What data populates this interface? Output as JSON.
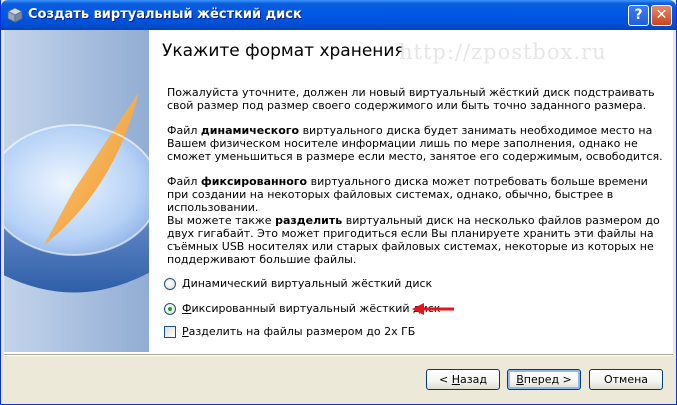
{
  "window": {
    "title": "Создать виртуальный жёсткий диск",
    "help_label": "?",
    "close_label": "✕"
  },
  "page": {
    "title": "Укажите формат хранения",
    "watermark": "http://zpostbox.ru"
  },
  "paragraphs": {
    "p1": "Пожалуйста уточните, должен ли новый виртуальный жёсткий диск подстраивать свой размер под размер своего содержимого или быть точно заданного размера.",
    "p2_pre": "Файл ",
    "p2_bold": "динамического",
    "p2_post": " виртуального диска будет занимать необходимое место на Вашем физическом носителе информации лишь по мере заполнения, однако не сможет уменьшиться в размере если место, занятое его содержимым, освободится.",
    "p3_pre": "Файл ",
    "p3_bold": "фиксированного",
    "p3_post": " виртуального диска может потребовать больше времени при создании на некоторых файловых системах, однако, обычно, быстрее в использовании.",
    "p4_pre": "Вы можете также ",
    "p4_bold": "разделить",
    "p4_post": " виртуальный диск на несколько файлов размером до двух гигабайт. Это может пригодиться если Вы планируете хранить эти файлы на съёмных USB носителях или старых файловых системах, некоторые из которых не поддерживают большие файлы."
  },
  "options": {
    "dynamic": {
      "label_pre": "",
      "label_ul": "Д",
      "label_post": "инамический виртуальный жёсткий диск",
      "selected": false
    },
    "fixed": {
      "label_pre": "",
      "label_ul": "Ф",
      "label_post": "иксированный виртуальный жёсткий диск",
      "selected": true
    },
    "split": {
      "label_pre": "",
      "label_ul": "Р",
      "label_post": "азделить на файлы размером до 2х ГБ",
      "checked": false
    }
  },
  "buttons": {
    "back_pre": "< ",
    "back_ul": "Н",
    "back_post": "азад",
    "next_pre": "",
    "next_ul": "В",
    "next_post": "перед >",
    "cancel": "Отмена"
  },
  "colors": {
    "titlebar": "#0058e6",
    "arrow": "#e8141c",
    "disk_top": "#9fc5f6",
    "disk_slice": "#f4a533"
  }
}
